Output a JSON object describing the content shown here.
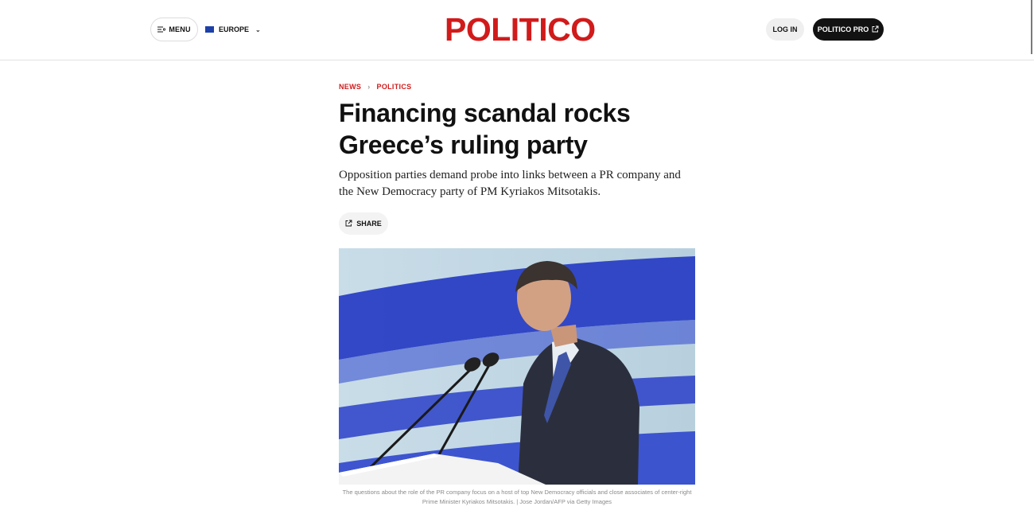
{
  "header": {
    "menu_label": "MENU",
    "edition_label": "EUROPE",
    "logo_text": "POLITICO",
    "login_label": "LOG IN",
    "pro_label": "POLITICO PRO",
    "brand_color": "#d11b1b"
  },
  "breadcrumb": {
    "items": [
      "NEWS",
      "POLITICS"
    ],
    "separator": "›"
  },
  "article": {
    "headline": "Financing scandal rocks Greece’s ruling party",
    "dek": "Opposition parties demand probe into links between a PR company and the New Democracy party of PM Kyriakos Mitsotakis.",
    "share_label": "SHARE",
    "caption": "The questions about the role of the PR company focus on a host of top New Democracy officials and close associates of center-right Prime Minister Kyriakos Mitsotakis. | Jose Jordan/AFP via Getty Images"
  },
  "icons": {
    "menu": "menu-lines-icon",
    "flag": "eu-flag-icon",
    "chevron": "chevron-down-icon",
    "external": "external-link-icon",
    "share": "share-icon"
  }
}
